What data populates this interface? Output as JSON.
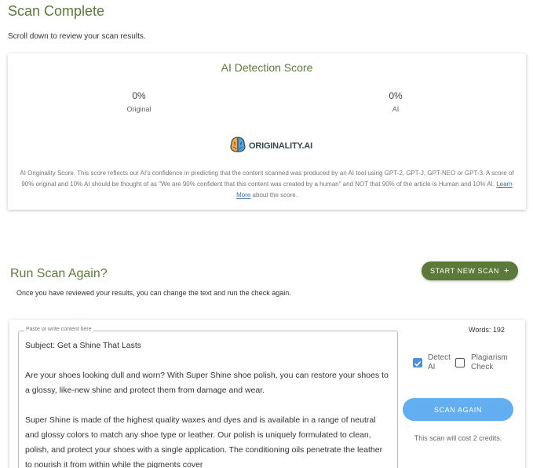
{
  "header": {
    "title": "Scan Complete",
    "subtitle": "Scroll down to review your scan results."
  },
  "score_card": {
    "heading": "AI Detection Score",
    "original_pct": "0%",
    "original_label": "Original",
    "ai_pct": "0%",
    "ai_label": "AI",
    "logo_text": "ORIGINALITY.AI",
    "disclaimer_before_link": "AI Originality Score. This score reflects our AI's confidence in predicting that the content scanned was produced by an AI tool using GPT-2, GPT-J, GPT-NEO or GPT-3. A score of 90% original and 10% AI should be thought of as \"We are 90% confident that this content was created by a human\" and NOT that 90% of the article is Human and 10% AI.",
    "learn_more": "Learn More",
    "disclaimer_after_link": "about the score."
  },
  "run_scan": {
    "title": "Run Scan Again?",
    "subtitle": "Once you have reviewed your results, you can change the text and run the check again.",
    "new_scan_label": "START NEW SCAN",
    "new_scan_icon": "+"
  },
  "editor": {
    "legend": "Paste or write content here",
    "content": "Subject: Get a Shine That Lasts\n\nAre your shoes looking dull and worn? With Super Shine shoe polish, you can restore your shoes to a glossy, like-new shine and protect them from damage and wear.\n\nSuper Shine is made of the highest quality waxes and dyes and is available in a range of neutral and glossy colors to match any shoe type or leather. Our polish is uniquely formulated to clean, polish, and protect your shoes with a single application. The conditioning oils penetrate the leather to nourish it from within while the pigments cover",
    "words": "Words: 192",
    "detect_ai_label": "Detect AI",
    "detect_ai_checked": true,
    "plagiarism_label": "Plagiarism Check",
    "plagiarism_checked": false,
    "scan_again_label": "SCAN AGAIN",
    "cost_text": "This scan will cost 2 credits."
  },
  "colors": {
    "accent_green": "#5b7a3a",
    "button_blue": "#63aef1",
    "checkbox_blue": "#4f8fd8",
    "link_blue": "#3a6fb5"
  }
}
